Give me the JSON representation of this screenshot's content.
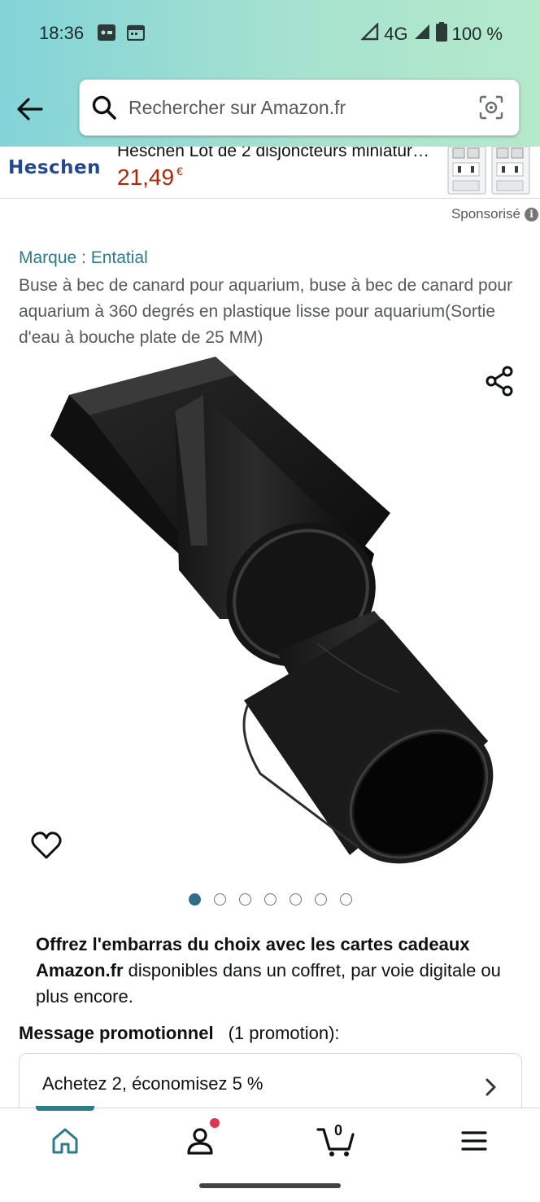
{
  "status_bar": {
    "time": "18:36",
    "network": "4G",
    "battery": "100 %"
  },
  "search": {
    "placeholder": "Rechercher sur Amazon.fr"
  },
  "ad": {
    "brand_logo": "Heschen",
    "title": "Heschen Lot de 2 disjoncteurs miniatur…",
    "price": "21,49",
    "currency": "€"
  },
  "sponsored": {
    "label": "Sponsorisé"
  },
  "product": {
    "brand": "Marque : Entatial",
    "title": "Buse à bec de canard pour aquarium, buse à bec de canard pour aquarium à 360 degrés en plastique lisse pour aquarium(Sortie d'eau à bouche plate de 25 MM)",
    "image_count": 7,
    "active_image": 1
  },
  "gift": {
    "bold": "Offrez l'embarras du choix avec les cartes cadeaux Amazon.fr",
    "rest": " disponibles dans un coffret, par voie digitale ou plus encore."
  },
  "promotion": {
    "label": "Message promotionnel",
    "count": "(1 promotion):",
    "offer": "Achetez 2, économisez 5 %"
  },
  "bottom_nav": {
    "cart_count": "0",
    "items": [
      "home-icon",
      "account-icon",
      "cart-icon",
      "menu-icon"
    ]
  },
  "colors": {
    "accent": "#2e7b8a",
    "price": "#b12704",
    "badge": "#e0344f"
  }
}
